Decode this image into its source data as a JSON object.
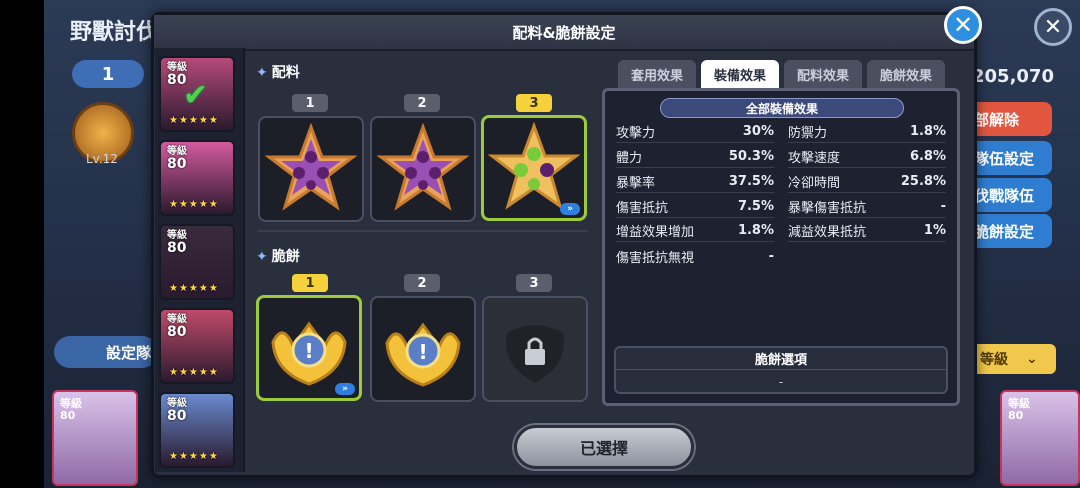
{
  "background": {
    "title": "野獸討伐",
    "team_tab": "1",
    "level": "Lv.12",
    "setting_button": "設定隊",
    "score": "205,070",
    "side_buttons": [
      "部解除",
      "隊伍設定",
      "伐戰隊伍",
      "脆餅設定"
    ],
    "grade_label": "等級",
    "bottom_cards": [
      {
        "label": "等級",
        "level": "80"
      },
      {
        "label": "等級",
        "level": "80"
      }
    ]
  },
  "modal": {
    "title": "配料&脆餅設定",
    "confirm_label": "已選擇"
  },
  "cookies": [
    {
      "label": "等級",
      "level": "80",
      "selected": true,
      "color": "#b64a7a"
    },
    {
      "label": "等級",
      "level": "80",
      "selected": false,
      "color": "#d45aa0"
    },
    {
      "label": "等級",
      "level": "80",
      "selected": false,
      "color": "#3a2a3e"
    },
    {
      "label": "等級",
      "level": "80",
      "selected": false,
      "color": "#c04a6a"
    },
    {
      "label": "等級",
      "level": "80",
      "selected": false,
      "color": "#6a8ad0"
    }
  ],
  "toppings": {
    "label": "配料",
    "slots": [
      {
        "number": "1",
        "active": false,
        "kind": "purple"
      },
      {
        "number": "2",
        "active": false,
        "kind": "purple"
      },
      {
        "number": "3",
        "active": true,
        "kind": "green",
        "more": "»"
      }
    ]
  },
  "tarts": {
    "label": "脆餅",
    "slots": [
      {
        "number": "1",
        "active": true,
        "kind": "gold",
        "more": "»"
      },
      {
        "number": "2",
        "active": false,
        "kind": "gold"
      },
      {
        "number": "3",
        "active": false,
        "kind": "locked"
      }
    ]
  },
  "tabs": [
    {
      "label": "套用效果",
      "active": false
    },
    {
      "label": "裝備效果",
      "active": true
    },
    {
      "label": "配料效果",
      "active": false
    },
    {
      "label": "脆餅效果",
      "active": false
    }
  ],
  "effects": {
    "header": "全部裝備效果",
    "rows": [
      [
        {
          "name": "攻擊力",
          "value": "30%"
        },
        {
          "name": "防禦力",
          "value": "1.8%"
        }
      ],
      [
        {
          "name": "體力",
          "value": "50.3%"
        },
        {
          "name": "攻擊速度",
          "value": "6.8%"
        }
      ],
      [
        {
          "name": "暴擊率",
          "value": "37.5%"
        },
        {
          "name": "冷卻時間",
          "value": "25.8%"
        }
      ],
      [
        {
          "name": "傷害抵抗",
          "value": "7.5%"
        },
        {
          "name": "暴擊傷害抵抗",
          "value": "-"
        }
      ],
      [
        {
          "name": "增益效果增加",
          "value": "1.8%"
        },
        {
          "name": "減益效果抵抗",
          "value": "1%"
        }
      ],
      [
        {
          "name": "傷害抵抗無視",
          "value": "-"
        },
        null
      ]
    ],
    "cookie_option_title": "脆餅選項",
    "cookie_option_value": "-"
  },
  "colors": {
    "accent_yellow": "#f5d23c",
    "selected_border": "#9ccb3a",
    "close_blue": "#2e8ee0"
  }
}
